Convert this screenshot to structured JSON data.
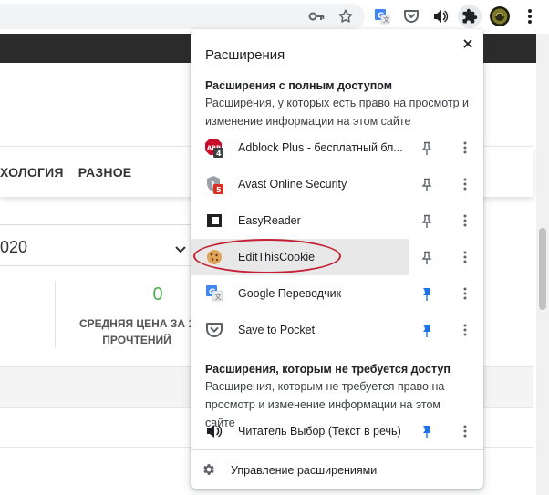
{
  "page": {
    "nav_items": [
      "ХОЛОГИЯ",
      "РАЗНОЕ"
    ],
    "date_value": "020",
    "stat_value": "0",
    "stat_label_lines": [
      "СРЕДНЯЯ ЦЕНА ЗА 1",
      "ПРОЧТЕНИЙ"
    ]
  },
  "toolbar": {
    "icons": [
      "key-icon",
      "star-icon",
      "translate-icon",
      "pocket-icon",
      "speaker-icon",
      "puzzle-icon",
      "avatar",
      "kebab-icon"
    ]
  },
  "popup": {
    "title": "Расширения",
    "full_access": {
      "heading": "Расширения с полным доступом",
      "description": "Расширения, у которых есть право на просмотр и изменение информации на этом сайте",
      "items": [
        {
          "name": "Adblock Plus - бесплатный бл...",
          "icon": "abp-icon",
          "badge": "4",
          "pinned": false
        },
        {
          "name": "Avast Online Security",
          "icon": "avast-icon",
          "badge": "5",
          "pinned": false
        },
        {
          "name": "EasyReader",
          "icon": "easyreader-icon",
          "badge": "",
          "pinned": false
        },
        {
          "name": "EditThisCookie",
          "icon": "cookie-icon",
          "badge": "",
          "pinned": false,
          "highlighted": true
        },
        {
          "name": "Google Переводчик",
          "icon": "translate-icon",
          "badge": "",
          "pinned": true
        },
        {
          "name": "Save to Pocket",
          "icon": "pocket-icon",
          "badge": "",
          "pinned": true
        }
      ]
    },
    "no_access": {
      "heading": "Расширения, которым не требуется доступ",
      "description": "Расширения, которым не требуется право на просмотр и изменение информации на этом сайте",
      "items": [
        {
          "name": "Читатель Выбор (Текст в речь)",
          "icon": "speaker-icon",
          "badge": "",
          "pinned": true
        }
      ]
    },
    "manage_label": "Управление расширениями"
  },
  "colors": {
    "pin_active": "#1a73e8",
    "pin_inactive": "#5f6368",
    "annotation": "#c42032",
    "stat_green": "#4caf50"
  }
}
